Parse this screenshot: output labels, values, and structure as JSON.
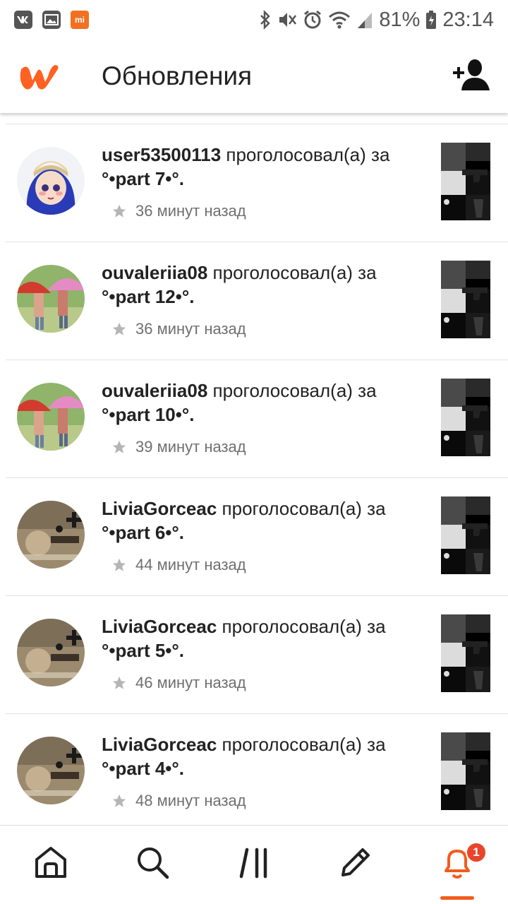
{
  "status_bar": {
    "left_icons": [
      "vk-icon",
      "gallery-icon",
      "mi-icon"
    ],
    "mi_label": "mi",
    "battery": "81%",
    "time": "23:14"
  },
  "app_bar": {
    "title": "Обновления",
    "logo_color": "#ff6122",
    "action_icon": "add-friend-icon"
  },
  "feed": {
    "items": [
      {
        "user": "user53500113",
        "action": " проголосовал(а) за",
        "story": "°•part 7•°.",
        "time": "36 минут назад",
        "avatar": "avatar-girl-hat"
      },
      {
        "user": "ouvaleriia08",
        "action": " проголосовал(а) за",
        "story": "°•part 12•°.",
        "time": "36 минут назад",
        "avatar": "avatar-umbrellas"
      },
      {
        "user": "ouvaleriia08",
        "action": " проголосовал(а) за",
        "story": "°•part 10•°.",
        "time": "39 минут назад",
        "avatar": "avatar-umbrellas"
      },
      {
        "user": "LiviaGorceac",
        "action": " проголосовал(а) за",
        "story": "°•part 6•°.",
        "time": "44 минут назад",
        "avatar": "avatar-vintage"
      },
      {
        "user": "LiviaGorceac",
        "action": " проголосовал(а) за",
        "story": "°•part 5•°.",
        "time": "46 минут назад",
        "avatar": "avatar-vintage"
      },
      {
        "user": "LiviaGorceac",
        "action": " проголосовал(а) за",
        "story": "°•part 4•°.",
        "time": "48 минут назад",
        "avatar": "avatar-vintage"
      }
    ]
  },
  "bottom_nav": {
    "items": [
      "home-icon",
      "search-icon",
      "library-icon",
      "write-icon",
      "notifications-icon"
    ],
    "active": "notifications-icon",
    "badge": "1",
    "accent": "#f25c1c"
  }
}
